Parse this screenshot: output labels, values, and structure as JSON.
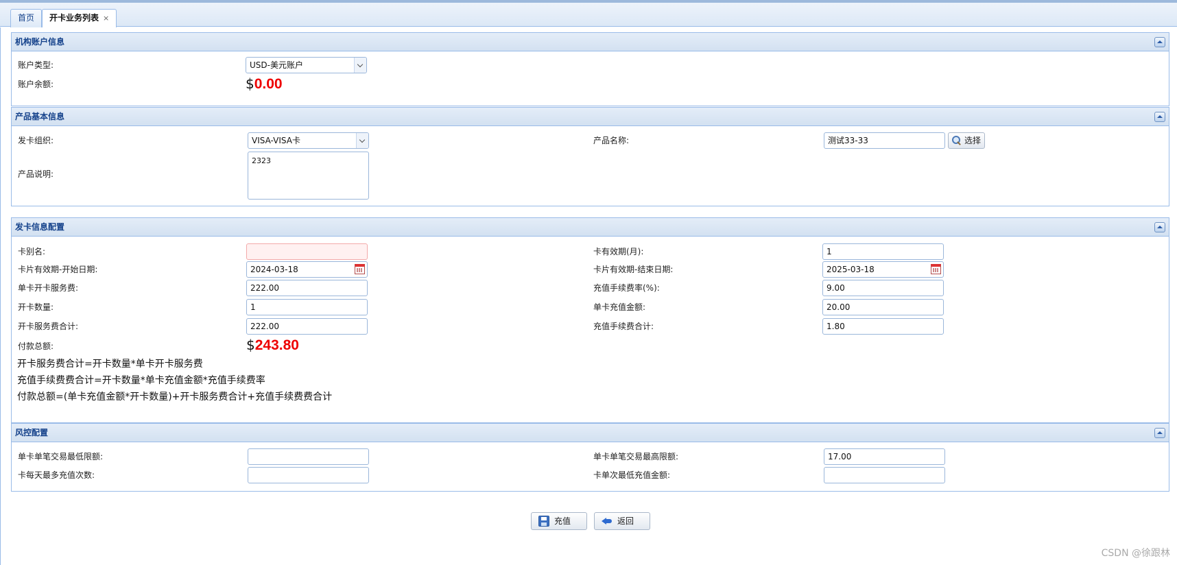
{
  "tabs": [
    {
      "label": "首页"
    },
    {
      "label": "开卡业务列表",
      "close": "×"
    }
  ],
  "panels": {
    "account": {
      "title": "机构账户信息",
      "account_type_label": "账户类型:",
      "account_type_value": "USD-美元账户",
      "balance_label": "账户余额:",
      "balance_currency": "$",
      "balance_amount": "0.00"
    },
    "product": {
      "title": "产品基本信息",
      "issuer_label": "发卡组织:",
      "issuer_value": "VISA-VISA卡",
      "name_label": "产品名称:",
      "name_value": "测试33-33",
      "select_button": "选择",
      "desc_label": "产品说明:",
      "desc_value": "2323"
    },
    "issue": {
      "title": "发卡信息配置",
      "alias_label": "卡别名:",
      "alias_value": "",
      "validity_label": "卡有效期(月):",
      "validity_value": "1",
      "start_label": "卡片有效期-开始日期:",
      "start_value": "2024-03-18",
      "end_label": "卡片有效期-结束日期:",
      "end_value": "2025-03-18",
      "service_fee_label": "单卡开卡服务费:",
      "service_fee_value": "222.00",
      "recharge_rate_label": "充值手续费率(%):",
      "recharge_rate_value": "9.00",
      "quantity_label": "开卡数量:",
      "quantity_value": "1",
      "recharge_amount_label": "单卡充值金额:",
      "recharge_amount_value": "20.00",
      "service_total_label": "开卡服务费合计:",
      "service_total_value": "222.00",
      "recharge_fee_total_label": "充值手续费合计:",
      "recharge_fee_total_value": "1.80",
      "payment_total_label": "付款总额:",
      "payment_currency": "$",
      "payment_amount": "243.80",
      "formula1": "开卡服务费合计=开卡数量*单卡开卡服务费",
      "formula2": "充值手续费费合计=开卡数量*单卡充值金额*充值手续费率",
      "formula3": "付款总额=(单卡充值金额*开卡数量)+开卡服务费合计+充值手续费费合计"
    },
    "risk": {
      "title": "风控配置",
      "min_txn_label": "单卡单笔交易最低限额:",
      "min_txn_value": "",
      "max_txn_label": "单卡单笔交易最高限额:",
      "max_txn_value": "17.00",
      "daily_recharge_label": "卡每天最多充值次数:",
      "daily_recharge_value": "",
      "min_recharge_label": "卡单次最低充值金额:",
      "min_recharge_value": ""
    }
  },
  "actions": {
    "recharge_label": "充值",
    "back_label": "返回"
  },
  "watermark": "CSDN @徐跟林",
  "icons": [
    "save-icon",
    "back-icon",
    "search-icon",
    "calendar-icon",
    "chevron-down-icon",
    "collapse-icon"
  ],
  "colors": {
    "accent": "#15428b",
    "amount": "#e00000",
    "border": "#99bbe8"
  }
}
